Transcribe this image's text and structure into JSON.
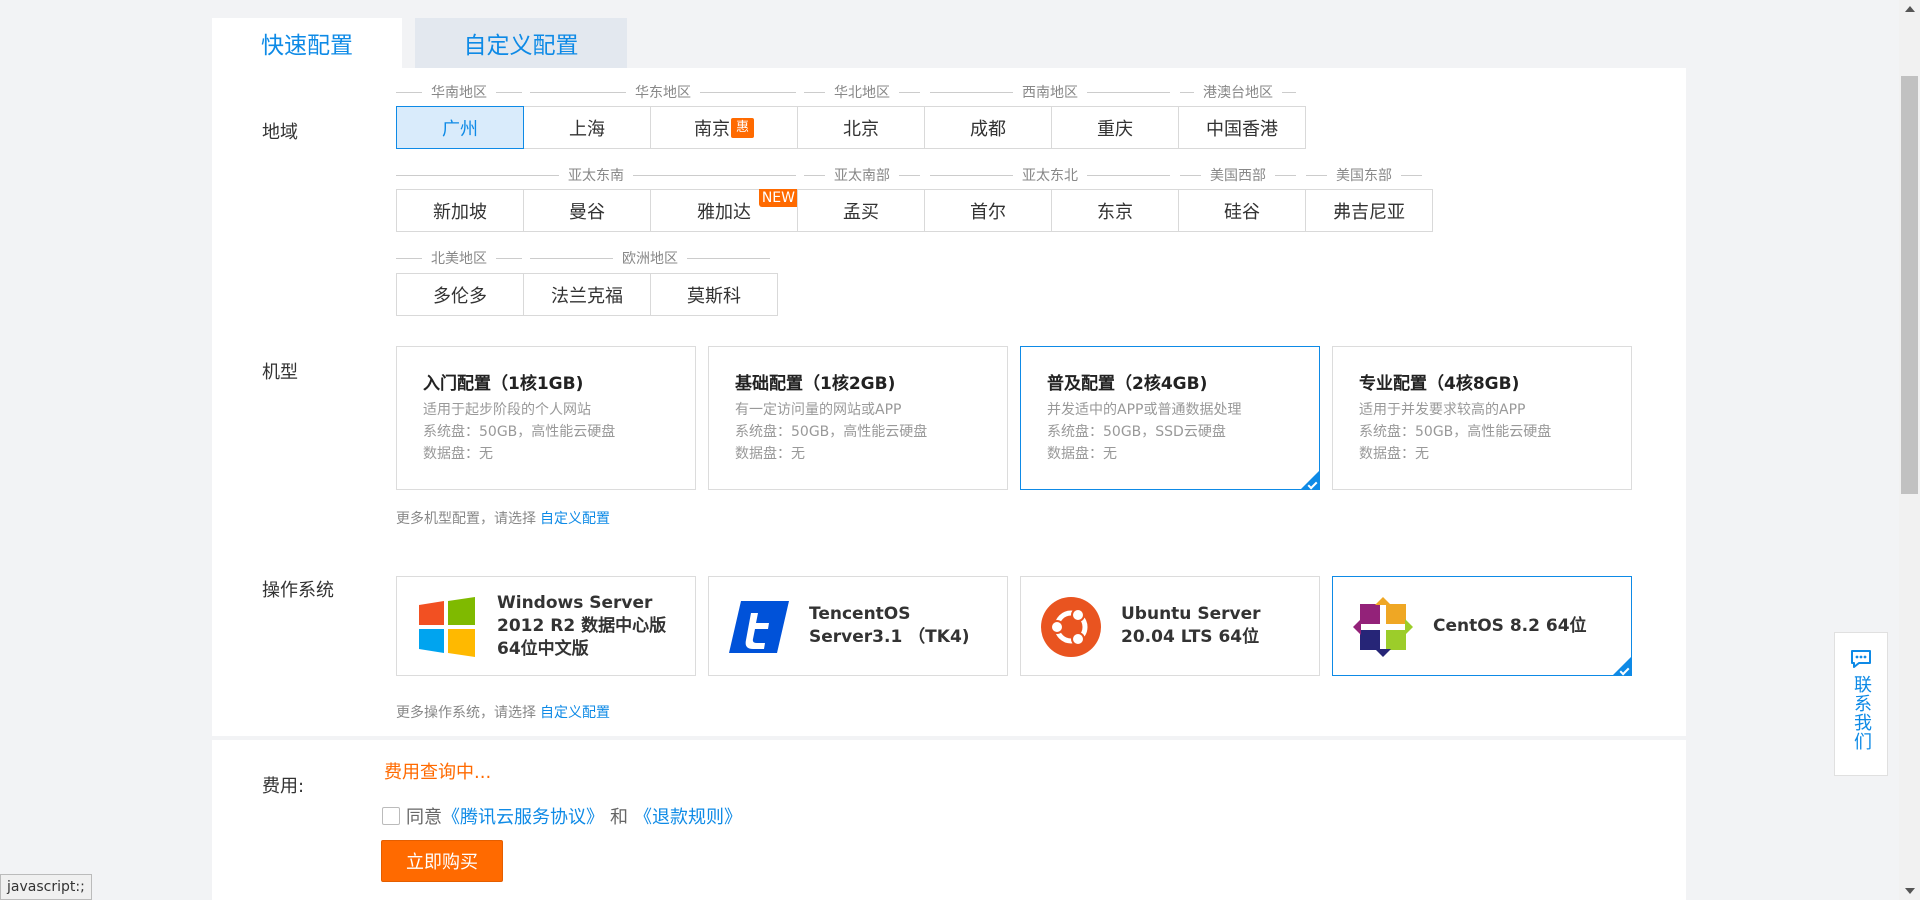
{
  "tabs": {
    "quick": "快速配置",
    "custom": "自定义配置"
  },
  "labels": {
    "region": "地域",
    "machine": "机型",
    "os": "操作系统",
    "fee": "费用:"
  },
  "regions": {
    "row1": {
      "headers": [
        "华南地区",
        "华东地区",
        "华北地区",
        "西南地区",
        "港澳台地区"
      ],
      "items": [
        "广州",
        "上海",
        "南京",
        "北京",
        "成都",
        "重庆",
        "中国香港"
      ],
      "nanjing_badge": "惠"
    },
    "row2": {
      "headers": [
        "亚太东南",
        "亚太南部",
        "亚太东北",
        "美国西部",
        "美国东部"
      ],
      "items": [
        "新加坡",
        "曼谷",
        "雅加达",
        "孟买",
        "首尔",
        "东京",
        "硅谷",
        "弗吉尼亚"
      ],
      "jakarta_badge": "NEW"
    },
    "row3": {
      "headers": [
        "北美地区",
        "欧洲地区"
      ],
      "items": [
        "多伦多",
        "法兰克福",
        "莫斯科"
      ]
    },
    "selected": "广州"
  },
  "machines": [
    {
      "title": "入门配置（1核1GB)",
      "d1": "适用于起步阶段的个人网站",
      "d2": "系统盘：50GB，高性能云硬盘",
      "d3": "数据盘：无"
    },
    {
      "title": "基础配置（1核2GB)",
      "d1": "有一定访问量的网站或APP",
      "d2": "系统盘：50GB，高性能云硬盘",
      "d3": "数据盘：无"
    },
    {
      "title": "普及配置（2核4GB)",
      "d1": "并发适中的APP或普通数据处理",
      "d2": "系统盘：50GB，SSD云硬盘",
      "d3": "数据盘：无"
    },
    {
      "title": "专业配置（4核8GB)",
      "d1": "适用于并发要求较高的APP",
      "d2": "系统盘：50GB，高性能云硬盘",
      "d3": "数据盘：无"
    }
  ],
  "machine_hint": {
    "text": "更多机型配置，请选择",
    "link": "自定义配置"
  },
  "os": [
    {
      "name": "Windows Server 2012 R2 数据中心版 64位中文版",
      "icon": "windows-icon"
    },
    {
      "name": "TencentOS Server3.1 （TK4)",
      "icon": "tencentos-icon"
    },
    {
      "name": "Ubuntu Server 20.04 LTS 64位",
      "icon": "ubuntu-icon"
    },
    {
      "name": "CentOS 8.2 64位",
      "icon": "centos-icon"
    }
  ],
  "os_hint": {
    "text": "更多操作系统，请选择",
    "link": "自定义配置"
  },
  "fee": {
    "value": "费用查询中..."
  },
  "agreement": {
    "prefix": "同意",
    "link1": "《腾讯云服务协议》",
    "and": "和",
    "link2": "《退款规则》"
  },
  "buy_button": "立即购买",
  "status_tip": "javascript:;",
  "contact": "联系我们",
  "colors": {
    "accent": "#0e8ae6",
    "orange": "#ff6a00"
  }
}
